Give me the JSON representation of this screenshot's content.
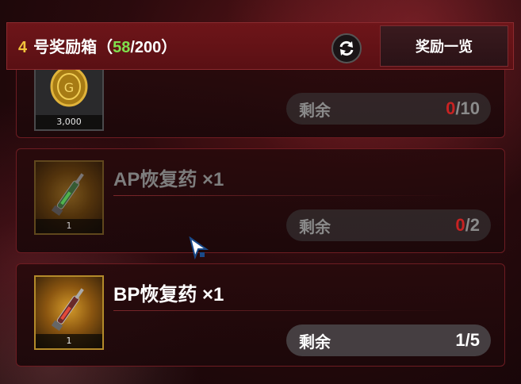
{
  "header": {
    "box_number": "4",
    "box_label": "号奖励箱",
    "count_open": "（",
    "count_current": "58",
    "count_total": "/200）",
    "refresh_icon": "refresh-icon",
    "list_button": "奖励一览"
  },
  "items": [
    {
      "name": "",
      "icon": "gold-coin-icon",
      "quantity": "3,000",
      "remain_label": "剩余",
      "remain_current": "0",
      "remain_total": "/10",
      "exhausted": true
    },
    {
      "name": "AP恢复药 ×1",
      "icon": "ap-potion-syringe-icon",
      "quantity": "1",
      "remain_label": "剩余",
      "remain_current": "0",
      "remain_total": "/2",
      "exhausted": true
    },
    {
      "name": "BP恢复药 ×1",
      "icon": "bp-potion-syringe-icon",
      "quantity": "1",
      "remain_label": "剩余",
      "remain_current": "1",
      "remain_total": "/5",
      "exhausted": false
    }
  ],
  "colors": {
    "accent_gold": "#f2c33b",
    "count_green": "#7fe04d",
    "zero_red": "#c82222",
    "header_red": "#6e1519"
  }
}
